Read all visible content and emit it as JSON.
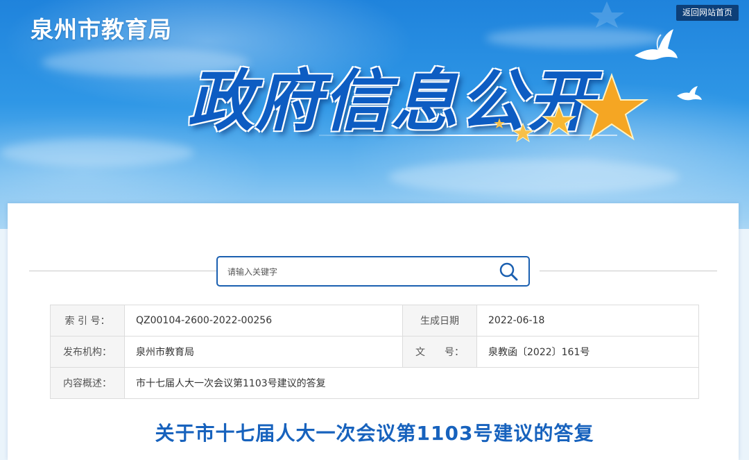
{
  "header": {
    "site_name": "泉州市教育局",
    "home_link": "返回网站首页",
    "hero_title": "政府信息公开"
  },
  "search": {
    "placeholder": "请输入关键字",
    "icon": "search-icon"
  },
  "meta": {
    "index_label": "索 引 号：",
    "index_value": "QZ00104-2600-2022-00256",
    "date_label": "生成日期",
    "date_value": "2022-06-18",
    "publisher_label": "发布机构：",
    "publisher_value": "泉州市教育局",
    "doc_no_label": "文　　号：",
    "doc_no_value": "泉教函〔2022〕161号",
    "summary_label": "内容概述：",
    "summary_value": "市十七届人大一次会议第1103号建议的答复"
  },
  "document": {
    "title": "关于市十七届人大一次会议第1103号建议的答复"
  },
  "colors": {
    "brand_blue": "#1762bd",
    "header_button": "#0d3f78",
    "star": "#f5a623"
  }
}
